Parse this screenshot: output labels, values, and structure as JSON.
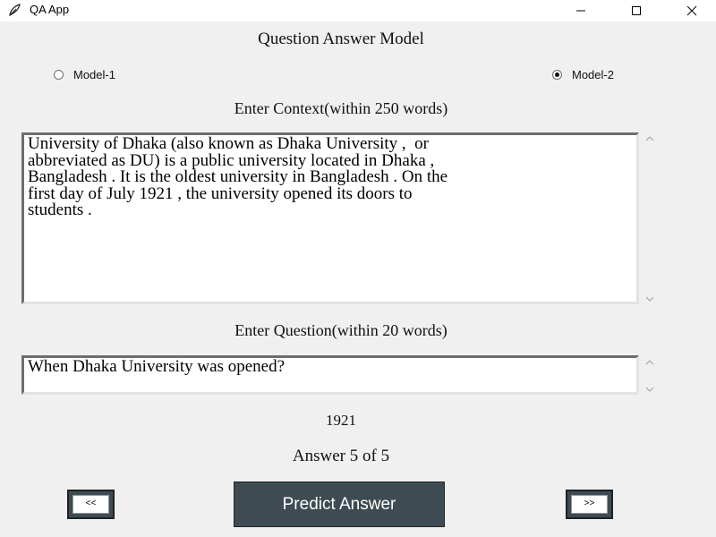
{
  "window": {
    "title": "QA App",
    "app_icon": "feather-icon",
    "controls": [
      "minimize-icon",
      "maximize-icon",
      "close-icon"
    ]
  },
  "main": {
    "title": "Question Answer Model",
    "models": [
      {
        "label": "Model-1",
        "selected": false
      },
      {
        "label": "Model-2",
        "selected": true
      }
    ],
    "context_label": "Enter Context(within 250 words)",
    "context_value": "University of Dhaka (also known as Dhaka University ,  or\nabbreviated as DU) is a public university located in Dhaka ,\nBangladesh . It is the oldest university in Bangladesh . On the\nfirst day of July 1921 , the university opened its doors to\nstudents .",
    "question_label": "Enter Question(within 20 words)",
    "question_value": "When Dhaka University was opened?",
    "answer": "1921",
    "answer_counter": "Answer 5 of 5"
  },
  "buttons": {
    "prev_label": "<<",
    "predict_label": "Predict Answer",
    "next_label": ">>"
  },
  "colors": {
    "window_bg": "#f0f0f0",
    "button_bg": "#3e4b52",
    "button_text": "#ffffff"
  }
}
